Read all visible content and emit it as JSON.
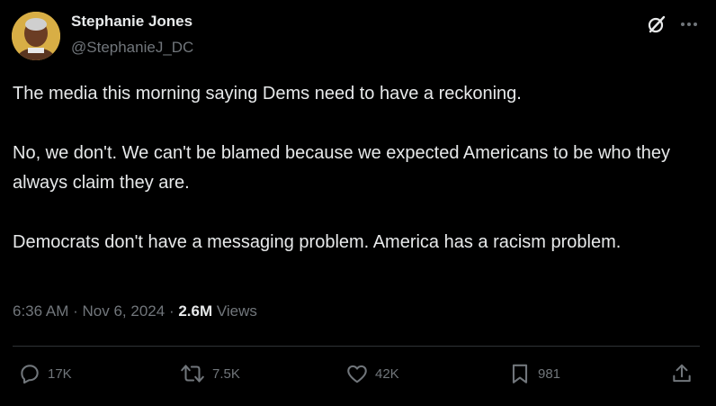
{
  "author": {
    "display_name": "Stephanie Jones",
    "handle": "@StephanieJ_DC"
  },
  "tweet": {
    "paragraphs": [
      "The media this morning saying Dems need to have a reckoning.",
      "No, we don't. We can't be blamed because we expected Americans to be who they always claim they are.",
      "Democrats don't have a messaging problem. America has a racism problem."
    ],
    "time": "6:36 AM",
    "separator": "·",
    "date": "Nov 6, 2024",
    "views_count": "2.6M",
    "views_label": "Views"
  },
  "actions": {
    "replies": "17K",
    "reposts": "7.5K",
    "likes": "42K",
    "bookmarks": "981"
  },
  "icons": {
    "grok": "grok-icon",
    "more": "more-icon",
    "reply": "reply-icon",
    "repost": "repost-icon",
    "like": "heart-icon",
    "bookmark": "bookmark-icon",
    "share": "share-icon"
  },
  "colors": {
    "background": "#000000",
    "primary_text": "#e7e9ea",
    "secondary_text": "#71767b",
    "divider": "#2f3336"
  }
}
